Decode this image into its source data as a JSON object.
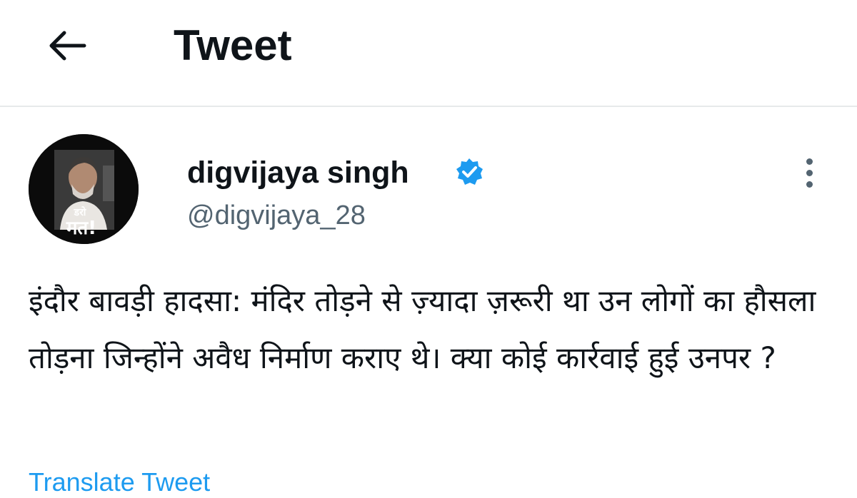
{
  "header": {
    "back_icon": "arrow-left-icon",
    "title": "Tweet"
  },
  "author": {
    "display_name": "digvijaya singh",
    "handle": "@digvijaya_28",
    "verified_icon": "verified-badge-icon",
    "avatar_overlay_small": "डरो",
    "avatar_overlay_large": "मत!"
  },
  "menu": {
    "icon": "more-vertical-icon"
  },
  "tweet": {
    "text": "इंदौर बावड़ी हादसा: मंदिर तोड़ने से ज़्यादा ज़रूरी था उन लोगों का हौसला तोड़ना जिन्होंने अवैध निर्माण कराए थे। क्या कोई कार्रवाई हुई उनपर ?"
  },
  "translate": {
    "label": "Translate Tweet"
  },
  "colors": {
    "text_primary": "#0f1419",
    "text_secondary": "#536471",
    "accent": "#1d9bf0",
    "divider": "#e7e9ea"
  }
}
